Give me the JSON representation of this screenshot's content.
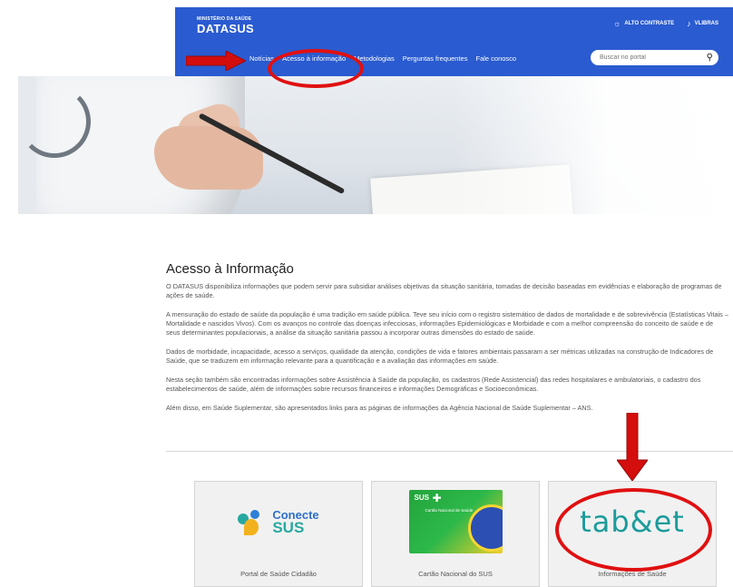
{
  "header": {
    "ministry": "MINISTÉRIO DA SAÚDE",
    "brand": "DATASUS",
    "contrast_label": "ALTO CONTRASTE",
    "vlibras_label": "VLIBRAS",
    "nav": [
      "Notícias",
      "Acesso à informação",
      "Metodologias",
      "Perguntas frequentes",
      "Fale conosco"
    ],
    "search_placeholder": "Buscar no portal"
  },
  "main": {
    "title": "Acesso à Informação",
    "paragraphs": [
      "O DATASUS disponibiliza informações que podem servir para subsidiar  análises objetivas da situação sanitária, tomadas de decisão baseadas em evidências e elaboração de programas de ações de saúde.",
      "A mensuração do estado de saúde da população é uma tradição em saúde pública. Teve seu início com o registro sistemático de dados de mortalidade e de sobrevivência (Estatísticas Vitais – Mortalidade e nascidos Vivos). Com os avanços no controle das doenças infecciosas, informações Epidemiológicas e Morbidade e com a melhor compreensão do conceito de saúde e de seus determinantes populacionais, a análise da situação sanitária passou a incorporar outras dimensões do estado de saúde.",
      "Dados de morbidade, incapacidade, acesso a serviços, qualidade da atenção, condições de vida e fatores ambientais passaram a ser métricas utilizadas na construção de Indicadores de Saúde, que se traduzem em informação relevante para a quantificação e a avaliação das informações em saúde.",
      "Nesta seção também são encontradas informações sobre Assistência à Saúde da população, os cadastros (Rede Assistencial) das redes hospitalares e ambulatoriais, o cadastro dos estabelecimentos de saúde, além de informações sobre  recursos financeiros e informações Demográficas e Socioeconômicas.",
      "Além disso, em Saúde Suplementar, são apresentados links para as páginas de informações da Agência Nacional de Saúde Suplementar – ANS."
    ]
  },
  "cards": [
    {
      "caption": "Portal de Saúde Cidadão",
      "logo_line1": "Conecte",
      "logo_line2": "SUS"
    },
    {
      "caption": "Cartão Nacional do SUS",
      "logo_sus": "SUS",
      "logo_sub": "Cartão Nacional de Saúde"
    },
    {
      "caption": "Informações de Saúde",
      "logo_text": "tab&et"
    }
  ],
  "colors": {
    "header_bg": "#2a5bd0",
    "annotation": "#e01010",
    "tabnet": "#1c9b9b"
  }
}
